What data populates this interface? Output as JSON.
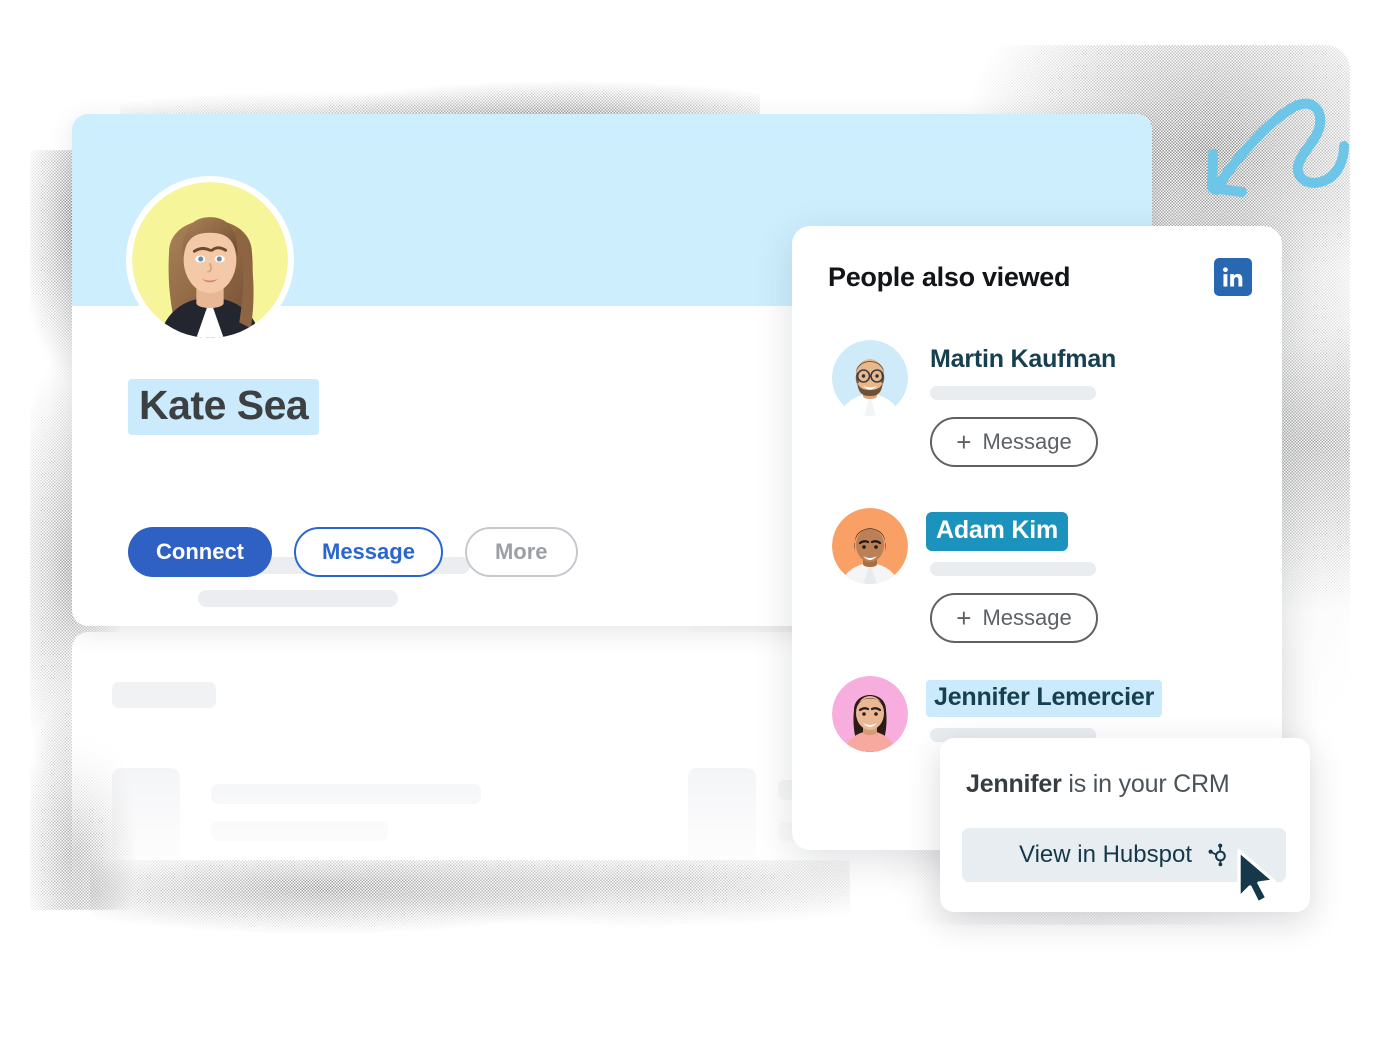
{
  "profile": {
    "name": "Kate Sea",
    "avatar_bg": "#f7f59a",
    "banner_color": "#cdeffd",
    "name_highlight_color": "#cbeafb",
    "actions": [
      {
        "label": "Connect",
        "style": "primary",
        "color": "#2f61c4"
      },
      {
        "label": "Message",
        "style": "outline-blue",
        "color": "#2a66d0"
      },
      {
        "label": "More",
        "style": "outline-gray",
        "color": "#9aa0a6"
      }
    ]
  },
  "people_panel": {
    "title": "People also viewed",
    "brand_icon": "linkedin-icon",
    "brand_color": "#2867b2",
    "people": [
      {
        "name": "Martin Kaufman",
        "highlight": "none",
        "avatar_bg": "#cfeaf8",
        "action_label": "Message",
        "action_icon": "plus-icon"
      },
      {
        "name": "Adam Kim",
        "highlight": "teal",
        "highlight_color": "#1b93bd",
        "avatar_bg": "#f9a066",
        "action_label": "Message",
        "action_icon": "plus-icon"
      },
      {
        "name": "Jennifer Lemercier",
        "highlight": "blue",
        "highlight_color": "#cbeafb",
        "avatar_bg": "#f7aede",
        "action_label": "",
        "action_icon": ""
      }
    ]
  },
  "crm_popover": {
    "text_bold": "Jennifer",
    "text_rest": " is in your CRM",
    "button_label": "View in Hubspot",
    "button_icon": "hubspot-icon",
    "button_bg": "#e8edf1"
  },
  "decorations": {
    "arrow_icon": "curved-arrow-icon",
    "arrow_color": "#6dc5e8",
    "cursor_icon": "mouse-cursor-icon",
    "cursor_color": "#15394b"
  }
}
